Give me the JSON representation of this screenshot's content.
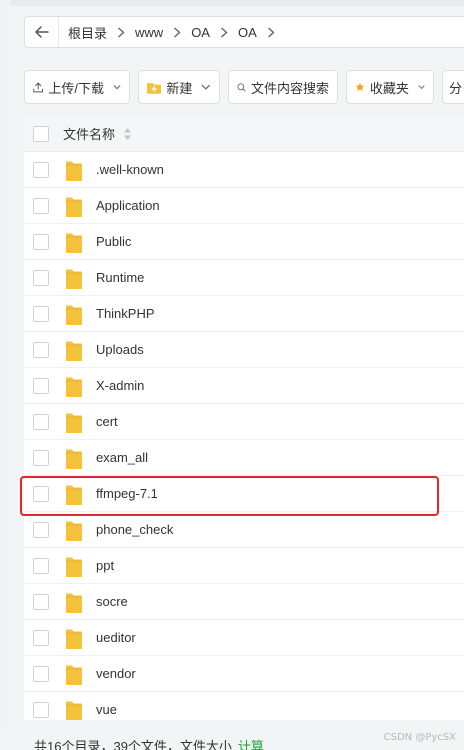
{
  "breadcrumb": [
    "根目录",
    "www",
    "OA",
    "OA"
  ],
  "toolbar": {
    "upload": "上传/下载",
    "new": "新建",
    "search_content": "文件内容搜索",
    "favorites": "收藏夹",
    "partial": "分"
  },
  "list": {
    "header": "文件名称",
    "rows": [
      ".well-known",
      "Application",
      "Public",
      "Runtime",
      "ThinkPHP",
      "Uploads",
      "X-admin",
      "cert",
      "exam_all",
      "ffmpeg-7.1",
      "phone_check",
      "ppt",
      "socre",
      "ueditor",
      "vendor",
      "vue"
    ],
    "highlighted": "ffmpeg-7.1"
  },
  "footer": {
    "summary": "共16个目录，39个文件，文件大小",
    "calc": "计算"
  },
  "watermark": "CSDN @PycSX",
  "colors": {
    "folder": "#f5c33b",
    "highlight": "#e5242b",
    "calc": "#20a53a"
  }
}
